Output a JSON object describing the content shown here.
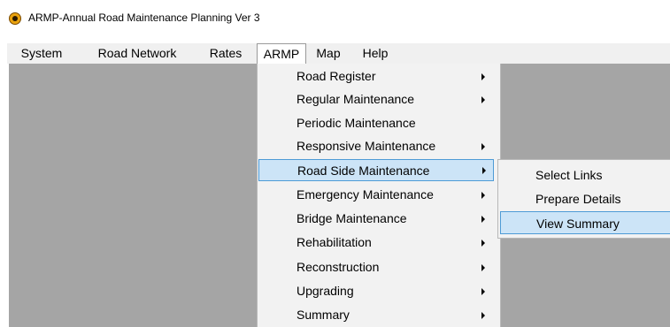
{
  "window": {
    "title": "ARMP-Annual Road Maintenance Planning Ver 3",
    "icon": "road-sign-icon"
  },
  "menubar": {
    "items": [
      "System",
      "Road Network",
      "Rates",
      "ARMP",
      "Map",
      "Help"
    ],
    "active": "ARMP"
  },
  "armp_menu": {
    "items": [
      {
        "label": "Road Register",
        "has_submenu": true
      },
      {
        "label": "Regular Maintenance",
        "has_submenu": true
      },
      {
        "label": "Periodic Maintenance",
        "has_submenu": false
      },
      {
        "label": "Responsive Maintenance",
        "has_submenu": true
      },
      {
        "label": "Road Side Maintenance",
        "has_submenu": true,
        "highlighted": true
      },
      {
        "label": "Emergency Maintenance",
        "has_submenu": true
      },
      {
        "label": "Bridge Maintenance",
        "has_submenu": true
      },
      {
        "label": "Rehabilitation",
        "has_submenu": true
      },
      {
        "label": "Reconstruction",
        "has_submenu": true
      },
      {
        "label": "Upgrading",
        "has_submenu": true
      },
      {
        "label": "Summary",
        "has_submenu": true
      }
    ]
  },
  "road_side_submenu": {
    "items": [
      {
        "label": "Select Links"
      },
      {
        "label": "Prepare Details"
      },
      {
        "label": "View Summary",
        "highlighted": true
      }
    ]
  },
  "colors": {
    "menu_highlight": "#cce4f7",
    "highlight_border": "#4e9bd6",
    "client_area": "#a5a5a5",
    "menubar": "#f0f0f0"
  }
}
